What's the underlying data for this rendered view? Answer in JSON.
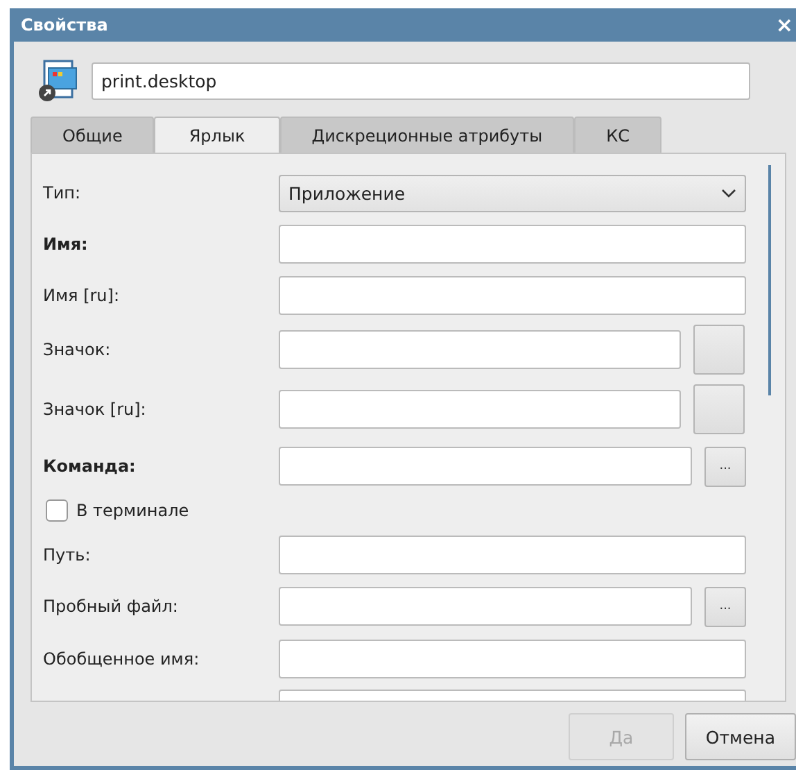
{
  "window": {
    "title": "Свойства",
    "close": "×"
  },
  "filename": {
    "value": "print.desktop"
  },
  "tabs": [
    {
      "label": "Общие",
      "selected": false
    },
    {
      "label": "Ярлык",
      "selected": true
    },
    {
      "label": "Дискреционные атрибуты",
      "selected": false
    },
    {
      "label": "КС",
      "selected": false
    }
  ],
  "rows": [
    {
      "kind": "combo",
      "label": "Тип:",
      "bold": false,
      "value": "Приложение"
    },
    {
      "kind": "field",
      "label": "Имя:",
      "bold": true
    },
    {
      "kind": "field",
      "label": "Имя [ru]:",
      "bold": false
    },
    {
      "kind": "icon",
      "label": "Значок:",
      "bold": false
    },
    {
      "kind": "icon",
      "label": "Значок [ru]:",
      "bold": false
    },
    {
      "kind": "browse",
      "label": "Команда:",
      "bold": true,
      "button": "..."
    },
    {
      "kind": "check",
      "label": "В терминале",
      "checked": false
    },
    {
      "kind": "field",
      "label": "Путь:",
      "bold": false
    },
    {
      "kind": "browse",
      "label": "Пробный файл:",
      "bold": false,
      "button": "..."
    },
    {
      "kind": "field",
      "label": "Обобщенное имя:",
      "bold": false
    },
    {
      "kind": "cut"
    }
  ],
  "buttons": [
    {
      "label": "Да",
      "disabled": true
    },
    {
      "label": "Отмена",
      "disabled": false
    }
  ]
}
